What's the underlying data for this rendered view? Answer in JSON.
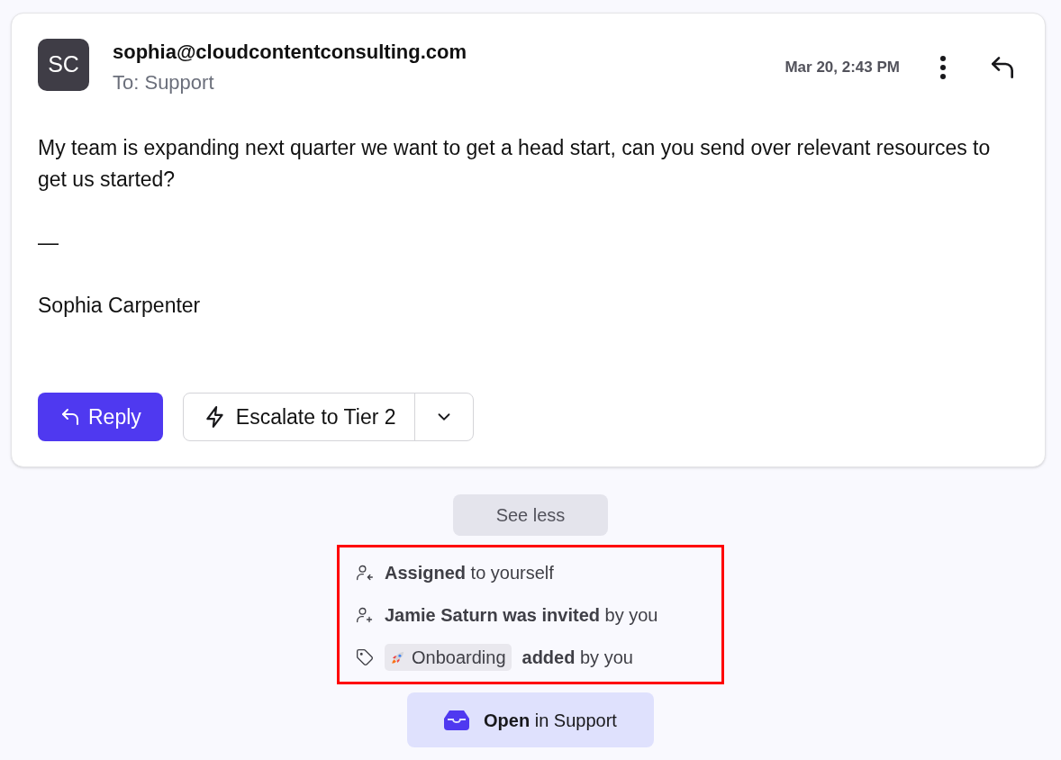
{
  "email": {
    "avatar_initials": "SC",
    "sender": "sophia@cloudcontentconsulting.com",
    "recipient": "To: Support",
    "timestamp": "Mar 20, 2:43 PM",
    "body": [
      "My team is expanding next quarter we want to get a head start, can you send over relevant resources to get us started?",
      "—",
      "Sophia Carpenter"
    ],
    "reply_button": "Reply",
    "escalate_button": "Escalate to Tier 2"
  },
  "see_less": "See less",
  "activity": [
    {
      "kind": "assigned",
      "text": "**Assigned** to yourself"
    },
    {
      "kind": "invited",
      "text": "**Jamie Saturn was invited** by you"
    },
    {
      "kind": "tag",
      "tag": "Onboarding",
      "text": "**added** by you"
    }
  ],
  "open_button": "**Open** in Support"
}
